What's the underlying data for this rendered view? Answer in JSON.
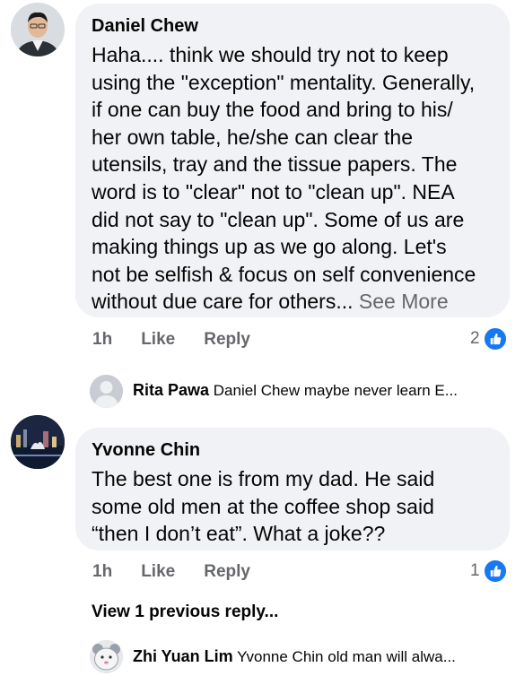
{
  "comments": [
    {
      "author": "Daniel Chew",
      "text": "Haha.... think we should try not to keep\nusing the \"exception\" mentality.  Generally,\nif one can buy the food and bring to his/\nher own table, he/she can clear the\nutensils, tray and the tissue papers.  The\nword is to \"clear\" not to \"clean up\". NEA\ndid not say to \"clean up\". Some of us are\nmaking things up as we go along. Let's\nnot be selfish & focus on self convenience\nwithout due care for others...",
      "see_more": " See More",
      "time": "1h",
      "like_label": "Like",
      "reply_label": "Reply",
      "reaction_count": "2",
      "reply_preview": {
        "author": "Rita Pawa",
        "text": "Daniel Chew  maybe never learn E..."
      }
    },
    {
      "author": "Yvonne Chin",
      "text": "The best one is from my dad. He said\nsome old men at the coffee shop said\n“then I don’t eat”.  What a joke??",
      "time": "1h",
      "like_label": "Like",
      "reply_label": "Reply",
      "reaction_count": "1",
      "view_previous": "View 1 previous reply...",
      "reply_preview": {
        "author": "Zhi Yuan Lim",
        "text": "Yvonne Chin old man will alwa..."
      }
    }
  ],
  "colors": {
    "bubble": "#f0f2f5",
    "meta_text": "#65676b",
    "like_blue": "#1877f2"
  }
}
